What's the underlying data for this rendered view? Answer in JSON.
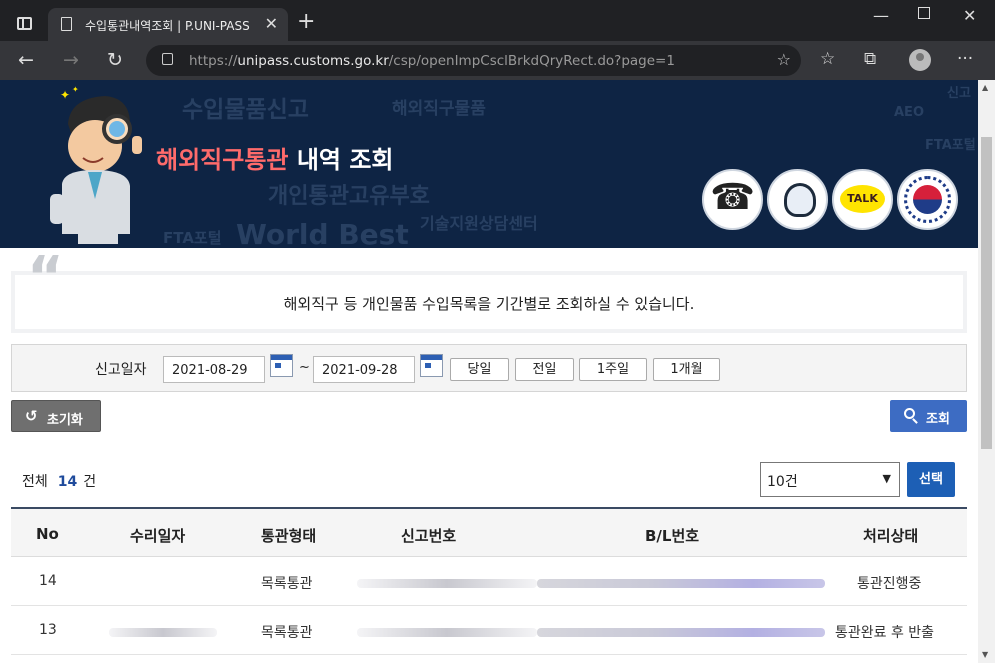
{
  "browser": {
    "tab_title": "수입통관내역조회 | P.UNI-PASS",
    "url_scheme": "https://",
    "url_host": "unipass.customs.go.kr",
    "url_path": "/csp/openImpCsclBrkdQryRect.do?page=1"
  },
  "banner": {
    "title_highlight": "해외직구통관",
    "title_rest": " 내역 조회",
    "watermarks": [
      "수입물품신고",
      "해외직구물품",
      "개인통관고유부호",
      "기술지원상담센터",
      "FTA포털",
      "World Best",
      "AEO",
      "FTA포털",
      "신고"
    ]
  },
  "info": {
    "text": "해외직구 등 개인물품 수입목록을 기간별로 조회하실 수 있습니다."
  },
  "search": {
    "label": "신고일자",
    "from": "2021-08-29",
    "to": "2021-09-28",
    "separator": "~",
    "periods": [
      "당일",
      "전일",
      "1주일",
      "1개월"
    ]
  },
  "actions": {
    "reset": "초기화",
    "query": "조회"
  },
  "summary": {
    "total_label": "전체",
    "total_count": "14",
    "unit": "건",
    "page_size": "10건",
    "select_button": "선택"
  },
  "table": {
    "columns": [
      "No",
      "수리일자",
      "통관형태",
      "신고번호",
      "B/L번호",
      "처리상태"
    ],
    "rows": [
      {
        "no": "14",
        "type": "목록통관",
        "status": "통관진행중"
      },
      {
        "no": "13",
        "type": "목록통관",
        "status": "통관완료 후 반출"
      }
    ]
  }
}
